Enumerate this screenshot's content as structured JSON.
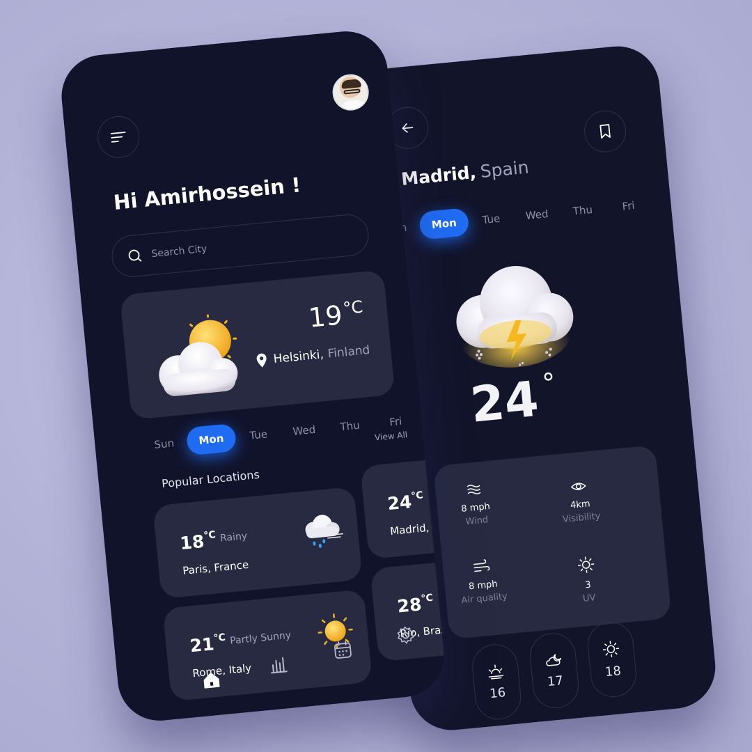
{
  "left": {
    "greeting": "Hi Amirhossein !",
    "search_placeholder": "Search City",
    "current": {
      "temp": "19",
      "unit": "°C",
      "city": "Helsinki,",
      "country": "Finland"
    },
    "days": [
      "Sun",
      "Mon",
      "Tue",
      "Wed",
      "Thu",
      "Fri"
    ],
    "active_day": "Mon",
    "popular_title": "Popular Locations",
    "view_all": "View All",
    "locations": [
      {
        "temp": "18",
        "unit": "°C",
        "condition": "Rainy",
        "city": "Paris, France",
        "icon": "rain-cloud-icon"
      },
      {
        "temp": "24",
        "unit": "°C",
        "condition": "",
        "city": "Madrid, S",
        "icon": ""
      },
      {
        "temp": "21",
        "unit": "°C",
        "condition": "Partly Sunny",
        "city": "Rome, Italy",
        "icon": "sun-icon"
      },
      {
        "temp": "28",
        "unit": "°C",
        "condition": "",
        "city": "Rio, Braz",
        "icon": ""
      }
    ],
    "nav": [
      "home-icon",
      "stats-icon",
      "calendar-icon",
      "settings-icon"
    ]
  },
  "right": {
    "city": "Madrid,",
    "country": "Spain",
    "days": [
      "Sun",
      "Mon",
      "Tue",
      "Wed",
      "Thu",
      "Fri"
    ],
    "active_day": "Mon",
    "temp": "24",
    "deg": "°",
    "stats": [
      {
        "icon": "wave-icon",
        "value": "8 mph",
        "label": "Wind"
      },
      {
        "icon": "eye-icon",
        "value": "4km",
        "label": "Visibility"
      },
      {
        "icon": "wind-icon",
        "value": "8 mph",
        "label": "Air quality"
      },
      {
        "icon": "sun-icon",
        "value": "3",
        "label": "UV"
      }
    ],
    "hourly": [
      {
        "icon": "sunrise-icon",
        "value": "16"
      },
      {
        "icon": "cloud-moon-icon",
        "value": "17"
      },
      {
        "icon": "sun-icon",
        "value": "18"
      }
    ]
  },
  "colors": {
    "accent": "#1f6cf2",
    "phone_bg": "#12142a",
    "card_bg": "#272a40",
    "page_bg": "#b8b8dc"
  }
}
